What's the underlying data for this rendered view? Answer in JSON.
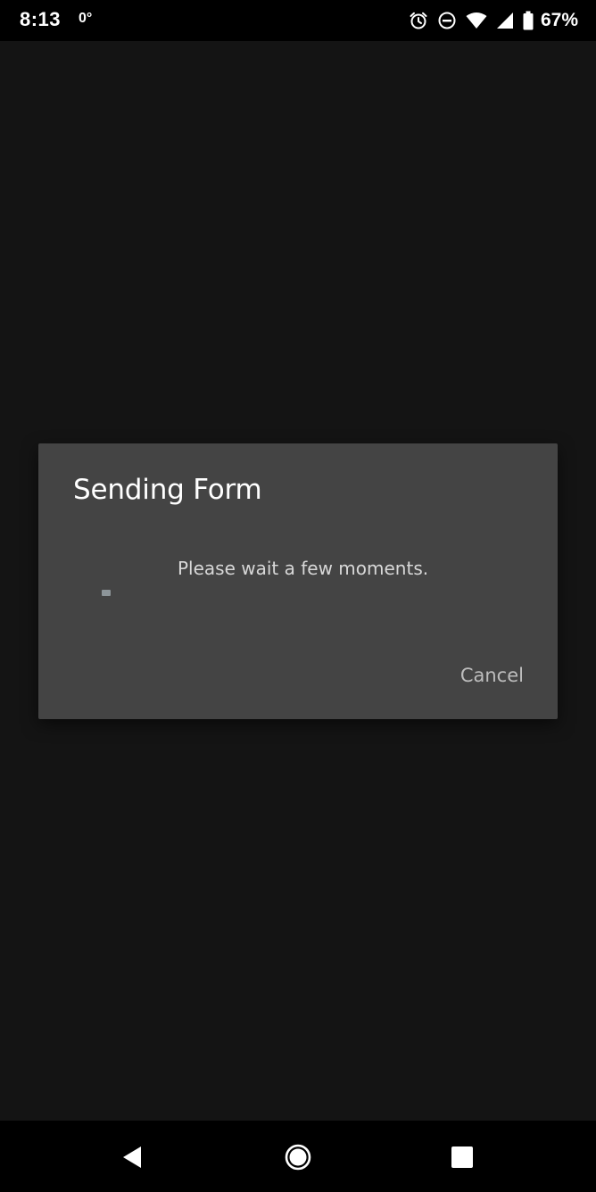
{
  "status_bar": {
    "time": "8:13",
    "temperature": "0°",
    "battery_percent": "67%",
    "icons": [
      "alarm-icon",
      "do-not-disturb-icon",
      "wifi-icon",
      "cell-signal-icon",
      "battery-icon"
    ]
  },
  "dialog": {
    "title": "Sending Form",
    "message": "Please wait a few moments.",
    "cancel_label": "Cancel"
  },
  "nav_bar": {
    "icons": [
      "back-icon",
      "home-icon",
      "recents-icon"
    ]
  },
  "colors": {
    "background": "#141414",
    "dialog_bg": "#444444",
    "bar_bg": "#000000",
    "title_text": "#ffffff",
    "body_text": "#d8d8d8",
    "button_text": "#bdbdbd"
  }
}
